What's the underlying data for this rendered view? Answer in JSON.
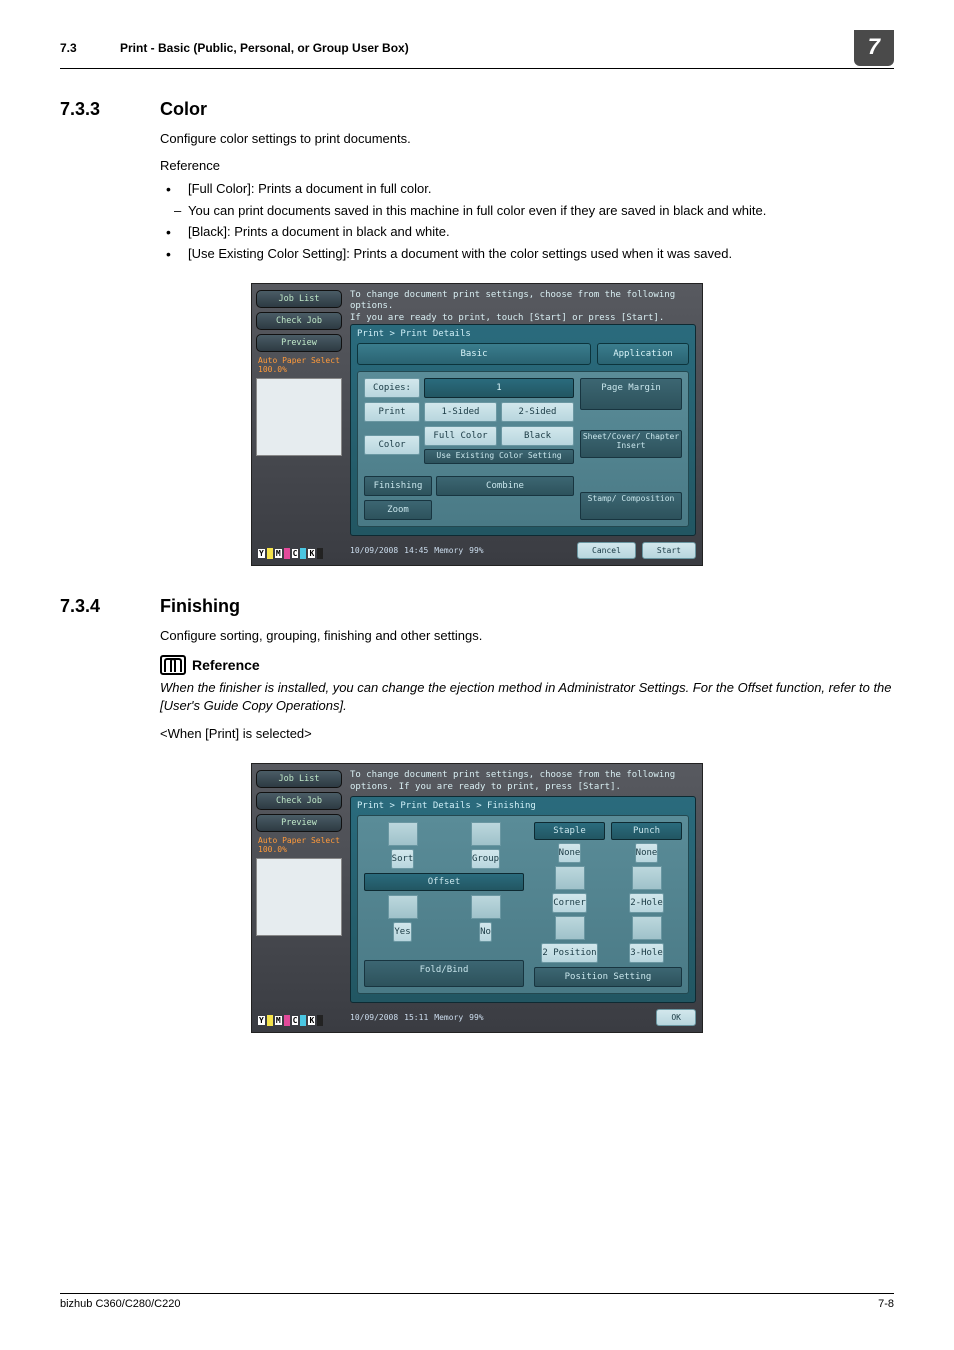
{
  "header": {
    "num": "7.3",
    "title": "Print - Basic (Public, Personal, or Group User Box)",
    "chip": "7"
  },
  "sec1": {
    "num": "7.3.3",
    "title": "Color",
    "p1": "Configure color settings to print documents.",
    "refLabel": "Reference",
    "b1": "[Full Color]: Prints a document in full color.",
    "b1a": "You can print documents saved in this machine in full color even if they are saved in black and white.",
    "b2": "[Black]: Prints a document in black and white.",
    "b3": "[Use Existing Color Setting]: Prints a document with the color settings used when it was saved."
  },
  "ss1": {
    "jobList": "Job List",
    "checkJob": "Check Job",
    "preview": "Preview",
    "auto": "Auto Paper Select  100.0%",
    "msg1": "To change document print settings, choose from the following options.",
    "msg2": "If you are ready to print, touch [Start] or press [Start].",
    "crumb": "Print > Print Details",
    "basic": "Basic",
    "application": "Application",
    "copies": "Copies:",
    "copiesVal": "1",
    "print": "Print",
    "oneSided": "1-Sided",
    "twoSided": "2-Sided",
    "color": "Color",
    "full": "Full Color",
    "black": "Black",
    "useExisting": "Use Existing Color Setting",
    "pageMargin": "Page Margin",
    "sheet": "Sheet/Cover/ Chapter Insert",
    "stamp": "Stamp/ Composition",
    "finishing": "Finishing",
    "combine": "Combine",
    "zoom": "Zoom",
    "date": "10/09/2008",
    "time": "14:45",
    "mem": "Memory",
    "memv": "99%",
    "cancel": "Cancel",
    "start": "Start"
  },
  "sec2": {
    "num": "7.3.4",
    "title": "Finishing",
    "p1": "Configure sorting, grouping, finishing and other settings.",
    "refBold": "Reference",
    "refItalic": "When the finisher is installed, you can change the ejection method in Administrator Settings. For the Offset function, refer to the [User's Guide Copy Operations].",
    "sel": "<When [Print] is selected>"
  },
  "ss2": {
    "jobList": "Job List",
    "checkJob": "Check Job",
    "preview": "Preview",
    "auto": "Auto Paper Select  100.0%",
    "msg": "To change document print settings, choose from the following options. If you are ready to print, press [Start].",
    "crumb": "Print > Print Details > Finishing",
    "sort": "Sort",
    "group": "Group",
    "offset": "Offset",
    "yes": "Yes",
    "no": "No",
    "staple": "Staple",
    "punch": "Punch",
    "none": "None",
    "corner": "Corner",
    "twoHole": "2-Hole",
    "twoPos": "2 Position",
    "threeHole": "3-Hole",
    "foldBind": "Fold/Bind",
    "posSet": "Position Setting",
    "date": "10/09/2008",
    "time": "15:11",
    "mem": "Memory",
    "memv": "99%",
    "ok": "OK"
  },
  "footer": {
    "left": "bizhub C360/C280/C220",
    "right": "7-8"
  }
}
